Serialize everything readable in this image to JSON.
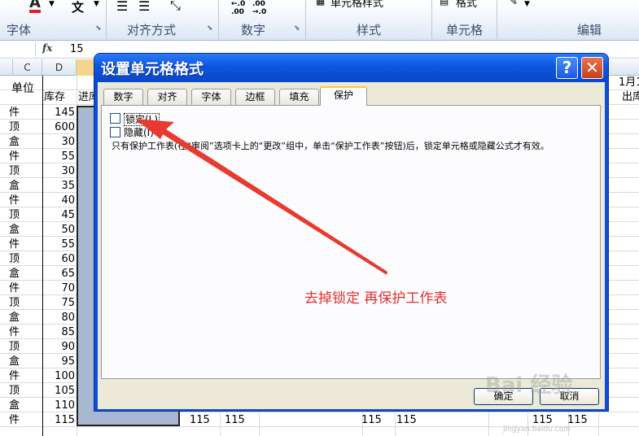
{
  "ribbon": {
    "groups": [
      {
        "label": "字体"
      },
      {
        "label": "对齐方式"
      },
      {
        "label": "数字"
      },
      {
        "label": "样式"
      },
      {
        "label": "单元格"
      },
      {
        "label": "编辑"
      }
    ],
    "top_items": [
      "单元格样式",
      "格式"
    ]
  },
  "formula_bar": {
    "fx": "fx",
    "value": "15"
  },
  "sheet": {
    "columns": [
      "C",
      "D"
    ],
    "headers": {
      "unit": "单位",
      "stock": "库存",
      "in": "进库",
      "month": "1月1",
      "out": "出库"
    },
    "rows": [
      {
        "unit": "件",
        "stock": "145"
      },
      {
        "unit": "顶",
        "stock": "600"
      },
      {
        "unit": "盒",
        "stock": "30"
      },
      {
        "unit": "件",
        "stock": "55"
      },
      {
        "unit": "顶",
        "stock": "30"
      },
      {
        "unit": "盒",
        "stock": "35"
      },
      {
        "unit": "件",
        "stock": "40"
      },
      {
        "unit": "顶",
        "stock": "45"
      },
      {
        "unit": "盒",
        "stock": "50"
      },
      {
        "unit": "件",
        "stock": "55"
      },
      {
        "unit": "顶",
        "stock": "60"
      },
      {
        "unit": "盒",
        "stock": "65"
      },
      {
        "unit": "件",
        "stock": "70"
      },
      {
        "unit": "顶",
        "stock": "75"
      },
      {
        "unit": "盒",
        "stock": "80"
      },
      {
        "unit": "件",
        "stock": "85"
      },
      {
        "unit": "顶",
        "stock": "90"
      },
      {
        "unit": "盒",
        "stock": "95"
      },
      {
        "unit": "件",
        "stock": "100"
      },
      {
        "unit": "顶",
        "stock": "105"
      },
      {
        "unit": "盒",
        "stock": "110"
      },
      {
        "unit": "件",
        "stock": "115"
      }
    ],
    "last_row_values": [
      "115",
      "115",
      "115",
      "115",
      "115",
      "115"
    ]
  },
  "dialog": {
    "title": "设置单元格格式",
    "help": "?",
    "close": "✕",
    "tabs": [
      "数字",
      "对齐",
      "字体",
      "边框",
      "填充",
      "保护"
    ],
    "active_tab": "保护",
    "locked_label": "锁定(L)",
    "hidden_label": "隐藏(I)",
    "description": "只有保护工作表(在“审阅”选项卡上的“更改”组中，单击“保护工作表”按钮)后，锁定单元格或隐藏公式才有效。",
    "ok": "确定",
    "cancel": "取消"
  },
  "annotation": {
    "text": "去掉锁定  再保护工作表",
    "color": "#e03030"
  },
  "watermark": {
    "text": "Bai 经验",
    "sub": "jingyan.baidu.com"
  }
}
